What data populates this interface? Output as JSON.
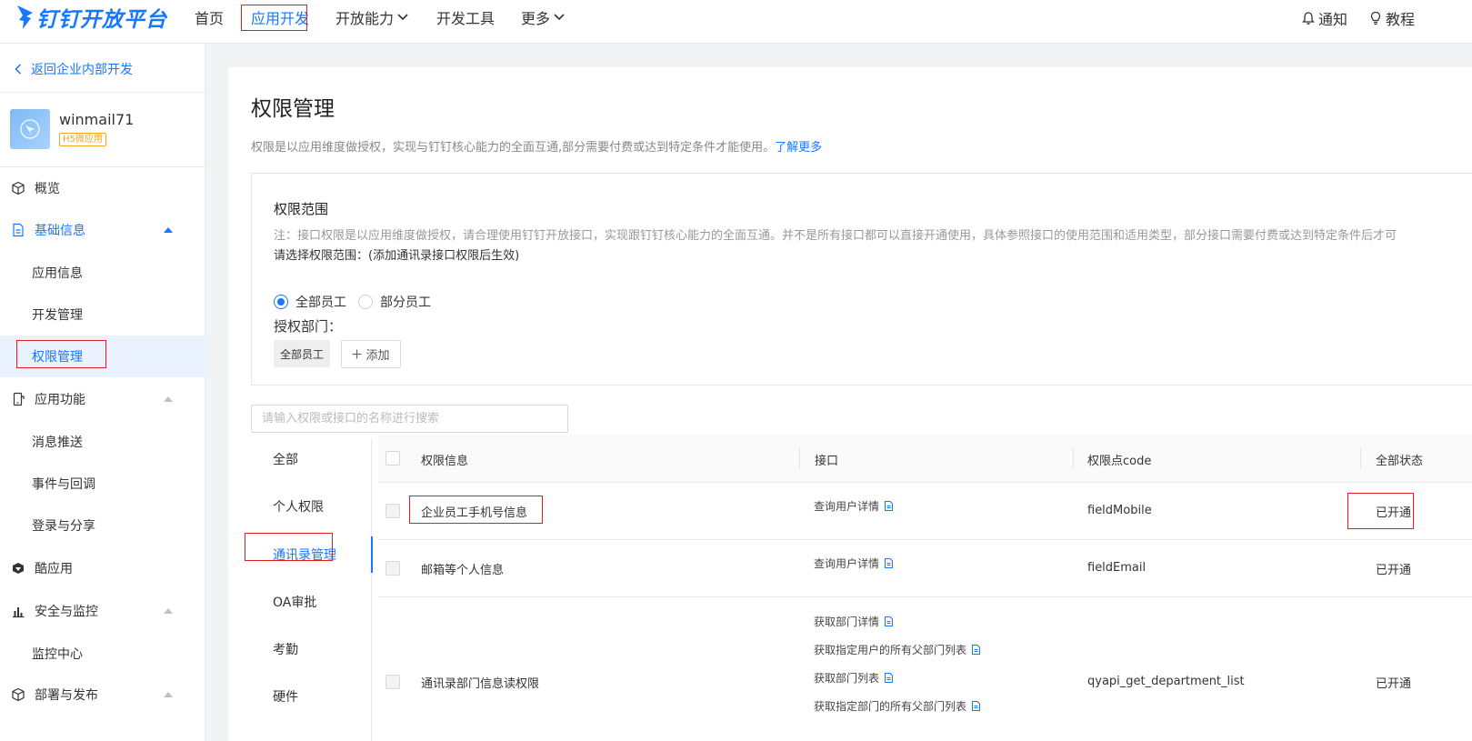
{
  "header": {
    "logo_text": "钉钉开放平台",
    "nav": [
      "首页",
      "应用开发",
      "开放能力",
      "开发工具",
      "更多"
    ],
    "notify_label": "通知",
    "tutorial_label": "教程"
  },
  "sidebar": {
    "back_label": "返回企业内部开发",
    "app_name": "winmail71",
    "app_tag": "H5微应用",
    "menu": {
      "overview": "概览",
      "basic_info": "基础信息",
      "app_info": "应用信息",
      "dev_mgmt": "开发管理",
      "perm_mgmt": "权限管理",
      "app_features": "应用功能",
      "msg_push": "消息推送",
      "events": "事件与回调",
      "login_share": "登录与分享",
      "cool_app": "酷应用",
      "security": "安全与监控",
      "monitor": "监控中心",
      "deploy": "部署与发布"
    }
  },
  "main": {
    "title": "权限管理",
    "desc": "权限是以应用维度做授权，实现与钉钉核心能力的全面互通,部分需要付费或达到特定条件才能使用。",
    "learn_more": "了解更多",
    "scope": {
      "title": "权限范围",
      "note": "注：接口权限是以应用维度做授权，请合理使用钉钉开放接口，实现跟钉钉核心能力的全面互通。并不是所有接口都可以直接开通使用，具体参照接口的使用范围和适用类型，部分接口需要付费或达到特定条件后才可",
      "choose": "请选择权限范围：(添加通讯录接口权限后生效)",
      "radio_all": "全部员工",
      "radio_part": "部分员工",
      "auth_dept_label": "授权部门：",
      "dept_tag": "全部员工",
      "add_label": "添加"
    },
    "search_placeholder": "请输入权限或接口的名称进行搜索",
    "categories": [
      "全部",
      "个人权限",
      "通讯录管理",
      "OA审批",
      "考勤",
      "硬件"
    ],
    "table": {
      "headers": {
        "info": "权限信息",
        "api": "接口",
        "code": "权限点code",
        "status": "全部状态"
      },
      "rows": [
        {
          "info": "企业员工手机号信息",
          "apis": [
            "查询用户详情"
          ],
          "code": "fieldMobile",
          "status": "已开通"
        },
        {
          "info": "邮箱等个人信息",
          "apis": [
            "查询用户详情"
          ],
          "code": "fieldEmail",
          "status": "已开通"
        },
        {
          "info": "通讯录部门信息读权限",
          "apis": [
            "获取部门详情",
            "获取指定用户的所有父部门列表",
            "获取部门列表",
            "获取指定部门的所有父部门列表"
          ],
          "code": "qyapi_get_department_list",
          "status": "已开通"
        }
      ]
    }
  },
  "colors": {
    "accent": "#1677ff",
    "annotation_red": "#e02020"
  }
}
